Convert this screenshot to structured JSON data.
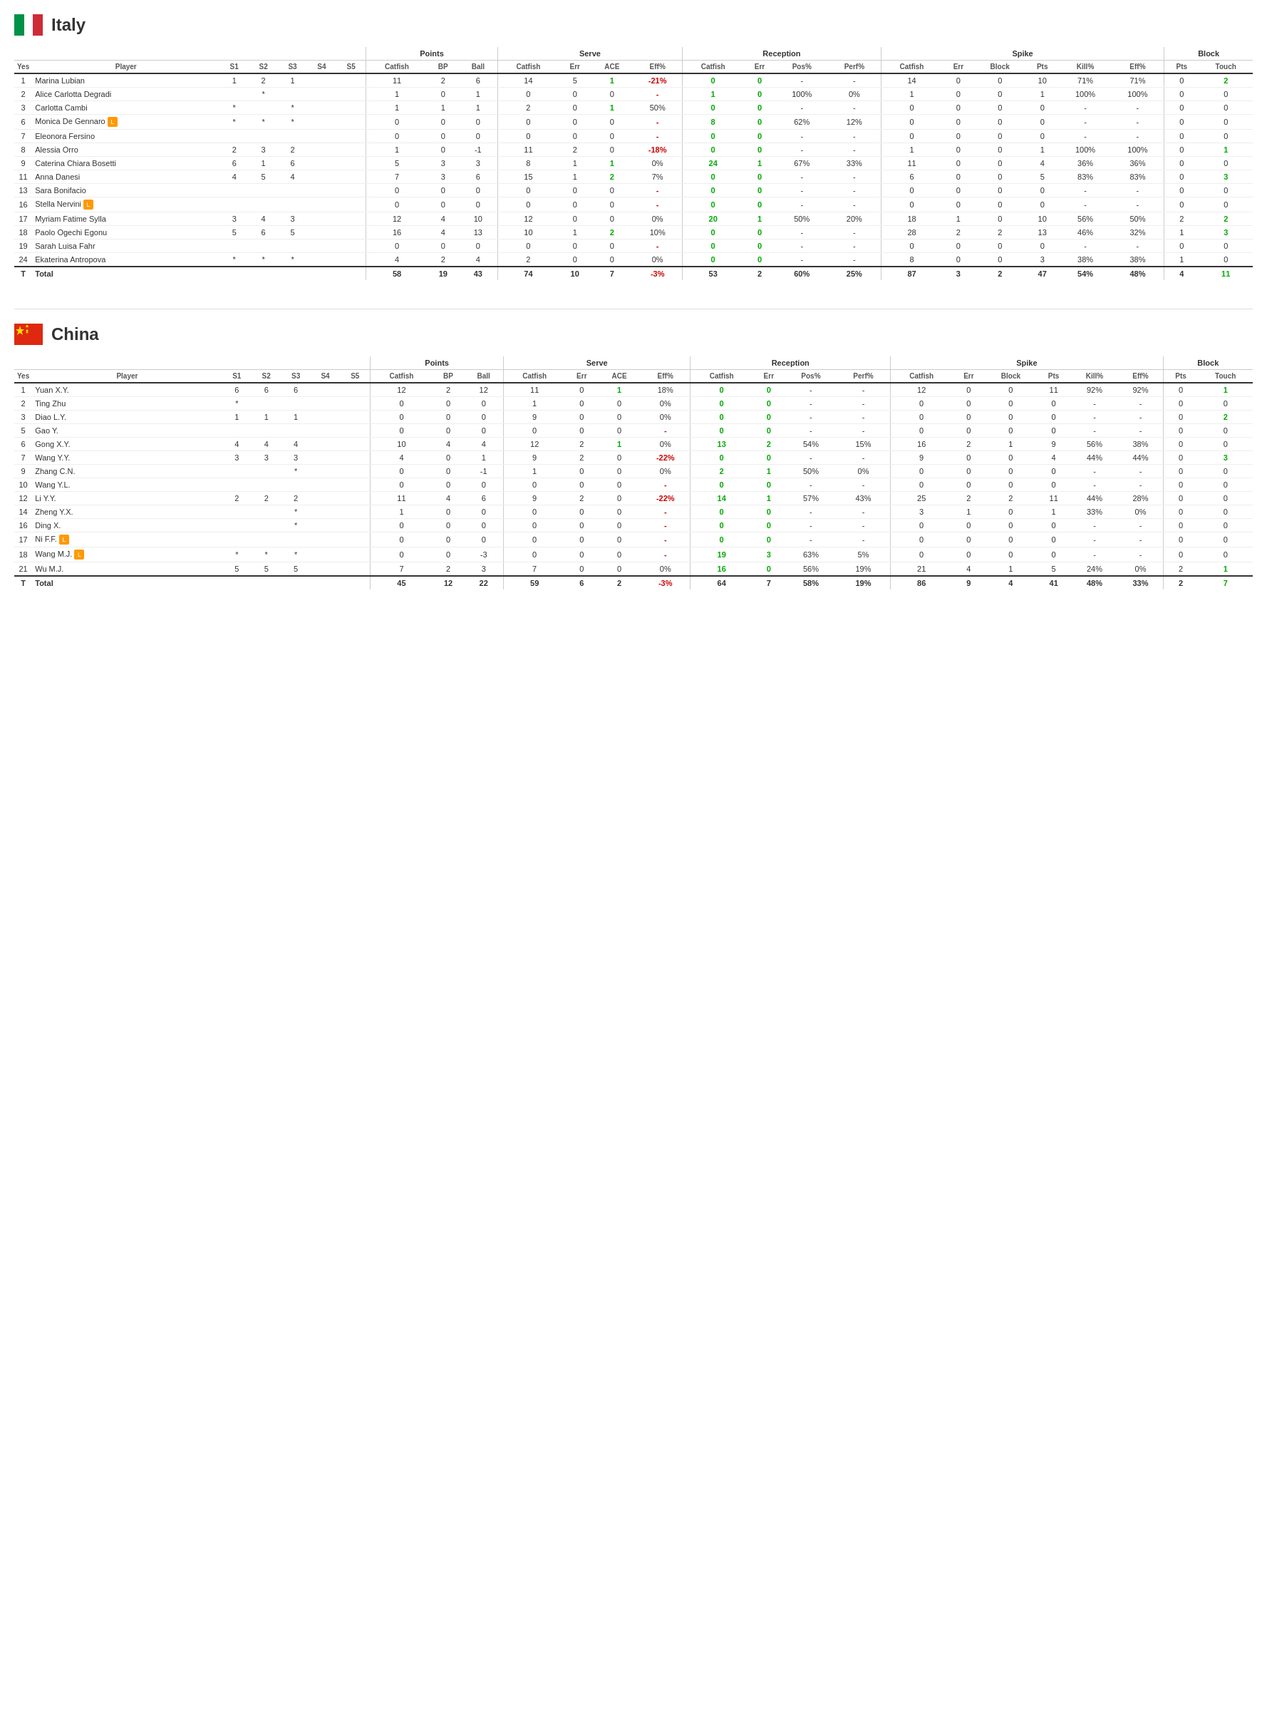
{
  "italy": {
    "name": "Italy",
    "players": [
      {
        "yes": "1",
        "name": "Marina Lubian",
        "s1": "1",
        "s2": "2",
        "s3": "1",
        "s4": "",
        "s5": "",
        "catfish": "11",
        "bp": "2",
        "ball": "6",
        "srv_catfish": "14",
        "srv_err": "5",
        "ace": "1",
        "eff": "-21%",
        "rec_catfish": "0",
        "rec_err": "0",
        "pos": "-",
        "perf": "-",
        "sp_catfish": "14",
        "sp_err": "0",
        "block": "0",
        "pts": "10",
        "kill": "71%",
        "sp_eff": "71%",
        "blk_pts": "0",
        "touch": "2",
        "badge": ""
      },
      {
        "yes": "2",
        "name": "Alice Carlotta Degradi",
        "s1": "",
        "s2": "*",
        "s3": "",
        "s4": "",
        "s5": "",
        "catfish": "1",
        "bp": "0",
        "ball": "1",
        "srv_catfish": "0",
        "srv_err": "0",
        "ace": "0",
        "eff": "-",
        "rec_catfish": "1",
        "rec_err": "0",
        "pos": "100%",
        "perf": "0%",
        "sp_catfish": "1",
        "sp_err": "0",
        "block": "0",
        "pts": "1",
        "kill": "100%",
        "sp_eff": "100%",
        "blk_pts": "0",
        "touch": "0",
        "badge": ""
      },
      {
        "yes": "3",
        "name": "Carlotta Cambi",
        "s1": "*",
        "s2": "",
        "s3": "*",
        "s4": "",
        "s5": "",
        "catfish": "1",
        "bp": "1",
        "ball": "1",
        "srv_catfish": "2",
        "srv_err": "0",
        "ace": "1",
        "eff": "50%",
        "rec_catfish": "0",
        "rec_err": "0",
        "pos": "-",
        "perf": "-",
        "sp_catfish": "0",
        "sp_err": "0",
        "block": "0",
        "pts": "0",
        "kill": "-",
        "sp_eff": "-",
        "blk_pts": "0",
        "touch": "0",
        "badge": ""
      },
      {
        "yes": "6",
        "name": "Monica De Gennaro",
        "s1": "*",
        "s2": "*",
        "s3": "*",
        "s4": "",
        "s5": "",
        "catfish": "0",
        "bp": "0",
        "ball": "0",
        "srv_catfish": "0",
        "srv_err": "0",
        "ace": "0",
        "eff": "-",
        "rec_catfish": "8",
        "rec_err": "0",
        "pos": "62%",
        "perf": "12%",
        "sp_catfish": "0",
        "sp_err": "0",
        "block": "0",
        "pts": "0",
        "kill": "-",
        "sp_eff": "-",
        "blk_pts": "0",
        "touch": "0",
        "badge": "L"
      },
      {
        "yes": "7",
        "name": "Eleonora Fersino",
        "s1": "",
        "s2": "",
        "s3": "",
        "s4": "",
        "s5": "",
        "catfish": "0",
        "bp": "0",
        "ball": "0",
        "srv_catfish": "0",
        "srv_err": "0",
        "ace": "0",
        "eff": "-",
        "rec_catfish": "0",
        "rec_err": "0",
        "pos": "-",
        "perf": "-",
        "sp_catfish": "0",
        "sp_err": "0",
        "block": "0",
        "pts": "0",
        "kill": "-",
        "sp_eff": "-",
        "blk_pts": "0",
        "touch": "0",
        "badge": ""
      },
      {
        "yes": "8",
        "name": "Alessia Orro",
        "s1": "2",
        "s2": "3",
        "s3": "2",
        "s4": "",
        "s5": "",
        "catfish": "1",
        "bp": "0",
        "ball": "-1",
        "srv_catfish": "11",
        "srv_err": "2",
        "ace": "0",
        "eff": "-18%",
        "rec_catfish": "0",
        "rec_err": "0",
        "pos": "-",
        "perf": "-",
        "sp_catfish": "1",
        "sp_err": "0",
        "block": "0",
        "pts": "1",
        "kill": "100%",
        "sp_eff": "100%",
        "blk_pts": "0",
        "touch": "1",
        "badge": ""
      },
      {
        "yes": "9",
        "name": "Caterina Chiara Bosetti",
        "s1": "6",
        "s2": "1",
        "s3": "6",
        "s4": "",
        "s5": "",
        "catfish": "5",
        "bp": "3",
        "ball": "3",
        "srv_catfish": "8",
        "srv_err": "1",
        "ace": "1",
        "eff": "0%",
        "rec_catfish": "24",
        "rec_err": "1",
        "pos": "67%",
        "perf": "33%",
        "sp_catfish": "11",
        "sp_err": "0",
        "block": "0",
        "pts": "4",
        "kill": "36%",
        "sp_eff": "36%",
        "blk_pts": "0",
        "touch": "0",
        "badge": ""
      },
      {
        "yes": "11",
        "name": "Anna Danesi",
        "s1": "4",
        "s2": "5",
        "s3": "4",
        "s4": "",
        "s5": "",
        "catfish": "7",
        "bp": "3",
        "ball": "6",
        "srv_catfish": "15",
        "srv_err": "1",
        "ace": "2",
        "eff": "7%",
        "rec_catfish": "0",
        "rec_err": "0",
        "pos": "-",
        "perf": "-",
        "sp_catfish": "6",
        "sp_err": "0",
        "block": "0",
        "pts": "5",
        "kill": "83%",
        "sp_eff": "83%",
        "blk_pts": "0",
        "touch": "3",
        "badge": ""
      },
      {
        "yes": "13",
        "name": "Sara Bonifacio",
        "s1": "",
        "s2": "",
        "s3": "",
        "s4": "",
        "s5": "",
        "catfish": "0",
        "bp": "0",
        "ball": "0",
        "srv_catfish": "0",
        "srv_err": "0",
        "ace": "0",
        "eff": "-",
        "rec_catfish": "0",
        "rec_err": "0",
        "pos": "-",
        "perf": "-",
        "sp_catfish": "0",
        "sp_err": "0",
        "block": "0",
        "pts": "0",
        "kill": "-",
        "sp_eff": "-",
        "blk_pts": "0",
        "touch": "0",
        "badge": ""
      },
      {
        "yes": "16",
        "name": "Stella Nervini",
        "s1": "",
        "s2": "",
        "s3": "",
        "s4": "",
        "s5": "",
        "catfish": "0",
        "bp": "0",
        "ball": "0",
        "srv_catfish": "0",
        "srv_err": "0",
        "ace": "0",
        "eff": "-",
        "rec_catfish": "0",
        "rec_err": "0",
        "pos": "-",
        "perf": "-",
        "sp_catfish": "0",
        "sp_err": "0",
        "block": "0",
        "pts": "0",
        "kill": "-",
        "sp_eff": "-",
        "blk_pts": "0",
        "touch": "0",
        "badge": "L"
      },
      {
        "yes": "17",
        "name": "Myriam Fatime Sylla",
        "s1": "3",
        "s2": "4",
        "s3": "3",
        "s4": "",
        "s5": "",
        "catfish": "12",
        "bp": "4",
        "ball": "10",
        "srv_catfish": "12",
        "srv_err": "0",
        "ace": "0",
        "eff": "0%",
        "rec_catfish": "20",
        "rec_err": "1",
        "pos": "50%",
        "perf": "20%",
        "sp_catfish": "18",
        "sp_err": "1",
        "block": "0",
        "pts": "10",
        "kill": "56%",
        "sp_eff": "50%",
        "blk_pts": "2",
        "touch": "2",
        "badge": ""
      },
      {
        "yes": "18",
        "name": "Paolo Ogechi Egonu",
        "s1": "5",
        "s2": "6",
        "s3": "5",
        "s4": "",
        "s5": "",
        "catfish": "16",
        "bp": "4",
        "ball": "13",
        "srv_catfish": "10",
        "srv_err": "1",
        "ace": "2",
        "eff": "10%",
        "rec_catfish": "0",
        "rec_err": "0",
        "pos": "-",
        "perf": "-",
        "sp_catfish": "28",
        "sp_err": "2",
        "block": "2",
        "pts": "13",
        "kill": "46%",
        "sp_eff": "32%",
        "blk_pts": "1",
        "touch": "3",
        "badge": ""
      },
      {
        "yes": "19",
        "name": "Sarah Luisa Fahr",
        "s1": "",
        "s2": "",
        "s3": "",
        "s4": "",
        "s5": "",
        "catfish": "0",
        "bp": "0",
        "ball": "0",
        "srv_catfish": "0",
        "srv_err": "0",
        "ace": "0",
        "eff": "-",
        "rec_catfish": "0",
        "rec_err": "0",
        "pos": "-",
        "perf": "-",
        "sp_catfish": "0",
        "sp_err": "0",
        "block": "0",
        "pts": "0",
        "kill": "-",
        "sp_eff": "-",
        "blk_pts": "0",
        "touch": "0",
        "badge": ""
      },
      {
        "yes": "24",
        "name": "Ekaterina Antropova",
        "s1": "*",
        "s2": "*",
        "s3": "*",
        "s4": "",
        "s5": "",
        "catfish": "4",
        "bp": "2",
        "ball": "4",
        "srv_catfish": "2",
        "srv_err": "0",
        "ace": "0",
        "eff": "0%",
        "rec_catfish": "0",
        "rec_err": "0",
        "pos": "-",
        "perf": "-",
        "sp_catfish": "8",
        "sp_err": "0",
        "block": "0",
        "pts": "3",
        "kill": "38%",
        "sp_eff": "38%",
        "blk_pts": "1",
        "touch": "0",
        "badge": ""
      }
    ],
    "total": {
      "yes": "T",
      "name": "Total",
      "catfish": "58",
      "bp": "19",
      "ball": "43",
      "srv_catfish": "74",
      "srv_err": "10",
      "ace": "7",
      "eff": "-3%",
      "rec_catfish": "53",
      "rec_err": "2",
      "pos": "60%",
      "perf": "25%",
      "sp_catfish": "87",
      "sp_err": "3",
      "block": "2",
      "pts": "47",
      "kill": "54%",
      "sp_eff": "48%",
      "blk_pts": "4",
      "touch": "11"
    }
  },
  "china": {
    "name": "China",
    "players": [
      {
        "yes": "1",
        "name": "Yuan X.Y.",
        "s1": "6",
        "s2": "6",
        "s3": "6",
        "s4": "",
        "s5": "",
        "catfish": "12",
        "bp": "2",
        "ball": "12",
        "srv_catfish": "11",
        "srv_err": "0",
        "ace": "1",
        "eff": "18%",
        "rec_catfish": "0",
        "rec_err": "0",
        "pos": "-",
        "perf": "-",
        "sp_catfish": "12",
        "sp_err": "0",
        "block": "0",
        "pts": "11",
        "kill": "92%",
        "sp_eff": "92%",
        "blk_pts": "0",
        "touch": "1",
        "badge": ""
      },
      {
        "yes": "2",
        "name": "Ting Zhu",
        "s1": "*",
        "s2": "",
        "s3": "",
        "s4": "",
        "s5": "",
        "catfish": "0",
        "bp": "0",
        "ball": "0",
        "srv_catfish": "1",
        "srv_err": "0",
        "ace": "0",
        "eff": "0%",
        "rec_catfish": "0",
        "rec_err": "0",
        "pos": "-",
        "perf": "-",
        "sp_catfish": "0",
        "sp_err": "0",
        "block": "0",
        "pts": "0",
        "kill": "-",
        "sp_eff": "-",
        "blk_pts": "0",
        "touch": "0",
        "badge": ""
      },
      {
        "yes": "3",
        "name": "Diao L.Y.",
        "s1": "1",
        "s2": "1",
        "s3": "1",
        "s4": "",
        "s5": "",
        "catfish": "0",
        "bp": "0",
        "ball": "0",
        "srv_catfish": "9",
        "srv_err": "0",
        "ace": "0",
        "eff": "0%",
        "rec_catfish": "0",
        "rec_err": "0",
        "pos": "-",
        "perf": "-",
        "sp_catfish": "0",
        "sp_err": "0",
        "block": "0",
        "pts": "0",
        "kill": "-",
        "sp_eff": "-",
        "blk_pts": "0",
        "touch": "2",
        "badge": ""
      },
      {
        "yes": "5",
        "name": "Gao Y.",
        "s1": "",
        "s2": "",
        "s3": "",
        "s4": "",
        "s5": "",
        "catfish": "0",
        "bp": "0",
        "ball": "0",
        "srv_catfish": "0",
        "srv_err": "0",
        "ace": "0",
        "eff": "-",
        "rec_catfish": "0",
        "rec_err": "0",
        "pos": "-",
        "perf": "-",
        "sp_catfish": "0",
        "sp_err": "0",
        "block": "0",
        "pts": "0",
        "kill": "-",
        "sp_eff": "-",
        "blk_pts": "0",
        "touch": "0",
        "badge": ""
      },
      {
        "yes": "6",
        "name": "Gong X.Y.",
        "s1": "4",
        "s2": "4",
        "s3": "4",
        "s4": "",
        "s5": "",
        "catfish": "10",
        "bp": "4",
        "ball": "4",
        "srv_catfish": "12",
        "srv_err": "2",
        "ace": "1",
        "eff": "0%",
        "rec_catfish": "13",
        "rec_err": "2",
        "pos": "54%",
        "perf": "15%",
        "sp_catfish": "16",
        "sp_err": "2",
        "block": "1",
        "pts": "9",
        "kill": "56%",
        "sp_eff": "38%",
        "blk_pts": "0",
        "touch": "0",
        "badge": ""
      },
      {
        "yes": "7",
        "name": "Wang Y.Y.",
        "s1": "3",
        "s2": "3",
        "s3": "3",
        "s4": "",
        "s5": "",
        "catfish": "4",
        "bp": "0",
        "ball": "1",
        "srv_catfish": "9",
        "srv_err": "2",
        "ace": "0",
        "eff": "-22%",
        "rec_catfish": "0",
        "rec_err": "0",
        "pos": "-",
        "perf": "-",
        "sp_catfish": "9",
        "sp_err": "0",
        "block": "0",
        "pts": "4",
        "kill": "44%",
        "sp_eff": "44%",
        "blk_pts": "0",
        "touch": "3",
        "badge": ""
      },
      {
        "yes": "9",
        "name": "Zhang C.N.",
        "s1": "",
        "s2": "",
        "s3": "*",
        "s4": "",
        "s5": "",
        "catfish": "0",
        "bp": "0",
        "ball": "-1",
        "srv_catfish": "1",
        "srv_err": "0",
        "ace": "0",
        "eff": "0%",
        "rec_catfish": "2",
        "rec_err": "1",
        "pos": "50%",
        "perf": "0%",
        "sp_catfish": "0",
        "sp_err": "0",
        "block": "0",
        "pts": "0",
        "kill": "-",
        "sp_eff": "-",
        "blk_pts": "0",
        "touch": "0",
        "badge": ""
      },
      {
        "yes": "10",
        "name": "Wang Y.L.",
        "s1": "",
        "s2": "",
        "s3": "",
        "s4": "",
        "s5": "",
        "catfish": "0",
        "bp": "0",
        "ball": "0",
        "srv_catfish": "0",
        "srv_err": "0",
        "ace": "0",
        "eff": "-",
        "rec_catfish": "0",
        "rec_err": "0",
        "pos": "-",
        "perf": "-",
        "sp_catfish": "0",
        "sp_err": "0",
        "block": "0",
        "pts": "0",
        "kill": "-",
        "sp_eff": "-",
        "blk_pts": "0",
        "touch": "0",
        "badge": ""
      },
      {
        "yes": "12",
        "name": "Li Y.Y.",
        "s1": "2",
        "s2": "2",
        "s3": "2",
        "s4": "",
        "s5": "",
        "catfish": "11",
        "bp": "4",
        "ball": "6",
        "srv_catfish": "9",
        "srv_err": "2",
        "ace": "0",
        "eff": "-22%",
        "rec_catfish": "14",
        "rec_err": "1",
        "pos": "57%",
        "perf": "43%",
        "sp_catfish": "25",
        "sp_err": "2",
        "block": "2",
        "pts": "11",
        "kill": "44%",
        "sp_eff": "28%",
        "blk_pts": "0",
        "touch": "0",
        "badge": ""
      },
      {
        "yes": "14",
        "name": "Zheng Y.X.",
        "s1": "",
        "s2": "",
        "s3": "*",
        "s4": "",
        "s5": "",
        "catfish": "1",
        "bp": "0",
        "ball": "0",
        "srv_catfish": "0",
        "srv_err": "0",
        "ace": "0",
        "eff": "-",
        "rec_catfish": "0",
        "rec_err": "0",
        "pos": "-",
        "perf": "-",
        "sp_catfish": "3",
        "sp_err": "1",
        "block": "0",
        "pts": "1",
        "kill": "33%",
        "sp_eff": "0%",
        "blk_pts": "0",
        "touch": "0",
        "badge": ""
      },
      {
        "yes": "16",
        "name": "Ding X.",
        "s1": "",
        "s2": "",
        "s3": "*",
        "s4": "",
        "s5": "",
        "catfish": "0",
        "bp": "0",
        "ball": "0",
        "srv_catfish": "0",
        "srv_err": "0",
        "ace": "0",
        "eff": "-",
        "rec_catfish": "0",
        "rec_err": "0",
        "pos": "-",
        "perf": "-",
        "sp_catfish": "0",
        "sp_err": "0",
        "block": "0",
        "pts": "0",
        "kill": "-",
        "sp_eff": "-",
        "blk_pts": "0",
        "touch": "0",
        "badge": ""
      },
      {
        "yes": "17",
        "name": "Ni F.F.",
        "s1": "",
        "s2": "",
        "s3": "",
        "s4": "",
        "s5": "",
        "catfish": "0",
        "bp": "0",
        "ball": "0",
        "srv_catfish": "0",
        "srv_err": "0",
        "ace": "0",
        "eff": "-",
        "rec_catfish": "0",
        "rec_err": "0",
        "pos": "-",
        "perf": "-",
        "sp_catfish": "0",
        "sp_err": "0",
        "block": "0",
        "pts": "0",
        "kill": "-",
        "sp_eff": "-",
        "blk_pts": "0",
        "touch": "0",
        "badge": "L"
      },
      {
        "yes": "18",
        "name": "Wang M.J.",
        "s1": "*",
        "s2": "*",
        "s3": "*",
        "s4": "",
        "s5": "",
        "catfish": "0",
        "bp": "0",
        "ball": "-3",
        "srv_catfish": "0",
        "srv_err": "0",
        "ace": "0",
        "eff": "-",
        "rec_catfish": "19",
        "rec_err": "3",
        "pos": "63%",
        "perf": "5%",
        "sp_catfish": "0",
        "sp_err": "0",
        "block": "0",
        "pts": "0",
        "kill": "-",
        "sp_eff": "-",
        "blk_pts": "0",
        "touch": "0",
        "badge": "L"
      },
      {
        "yes": "21",
        "name": "Wu M.J.",
        "s1": "5",
        "s2": "5",
        "s3": "5",
        "s4": "",
        "s5": "",
        "catfish": "7",
        "bp": "2",
        "ball": "3",
        "srv_catfish": "7",
        "srv_err": "0",
        "ace": "0",
        "eff": "0%",
        "rec_catfish": "16",
        "rec_err": "0",
        "pos": "56%",
        "perf": "19%",
        "sp_catfish": "21",
        "sp_err": "4",
        "block": "1",
        "pts": "5",
        "kill": "24%",
        "sp_eff": "0%",
        "blk_pts": "2",
        "touch": "1",
        "badge": ""
      }
    ],
    "total": {
      "yes": "T",
      "name": "Total",
      "catfish": "45",
      "bp": "12",
      "ball": "22",
      "srv_catfish": "59",
      "srv_err": "6",
      "ace": "2",
      "eff": "-3%",
      "rec_catfish": "64",
      "rec_err": "7",
      "pos": "58%",
      "perf": "19%",
      "sp_catfish": "86",
      "sp_err": "9",
      "block": "4",
      "pts": "41",
      "kill": "48%",
      "sp_eff": "33%",
      "blk_pts": "2",
      "touch": "7"
    }
  },
  "headers": {
    "yes": "Yes",
    "player": "Player",
    "s1": "S1",
    "s2": "S2",
    "s3": "S3",
    "s4": "S4",
    "s5": "S5",
    "points": "Points",
    "catfish": "Catfish",
    "bp": "BP",
    "ball": "Ball",
    "serve": "Serve",
    "srv_catfish": "Catfish",
    "srv_err": "Err",
    "ace": "ACE",
    "srv_eff": "Eff%",
    "reception": "Reception",
    "rec_catfish": "Catfish",
    "rec_err": "Err",
    "pos": "Pos%",
    "perf": "Perf%",
    "spike": "Spike",
    "sp_catfish": "Catfish",
    "sp_err": "Err",
    "block": "Block",
    "pts": "Pts",
    "kill": "Kill%",
    "sp_eff": "Eff%",
    "block_section": "Block",
    "blk_pts": "Pts",
    "touch": "Touch"
  }
}
